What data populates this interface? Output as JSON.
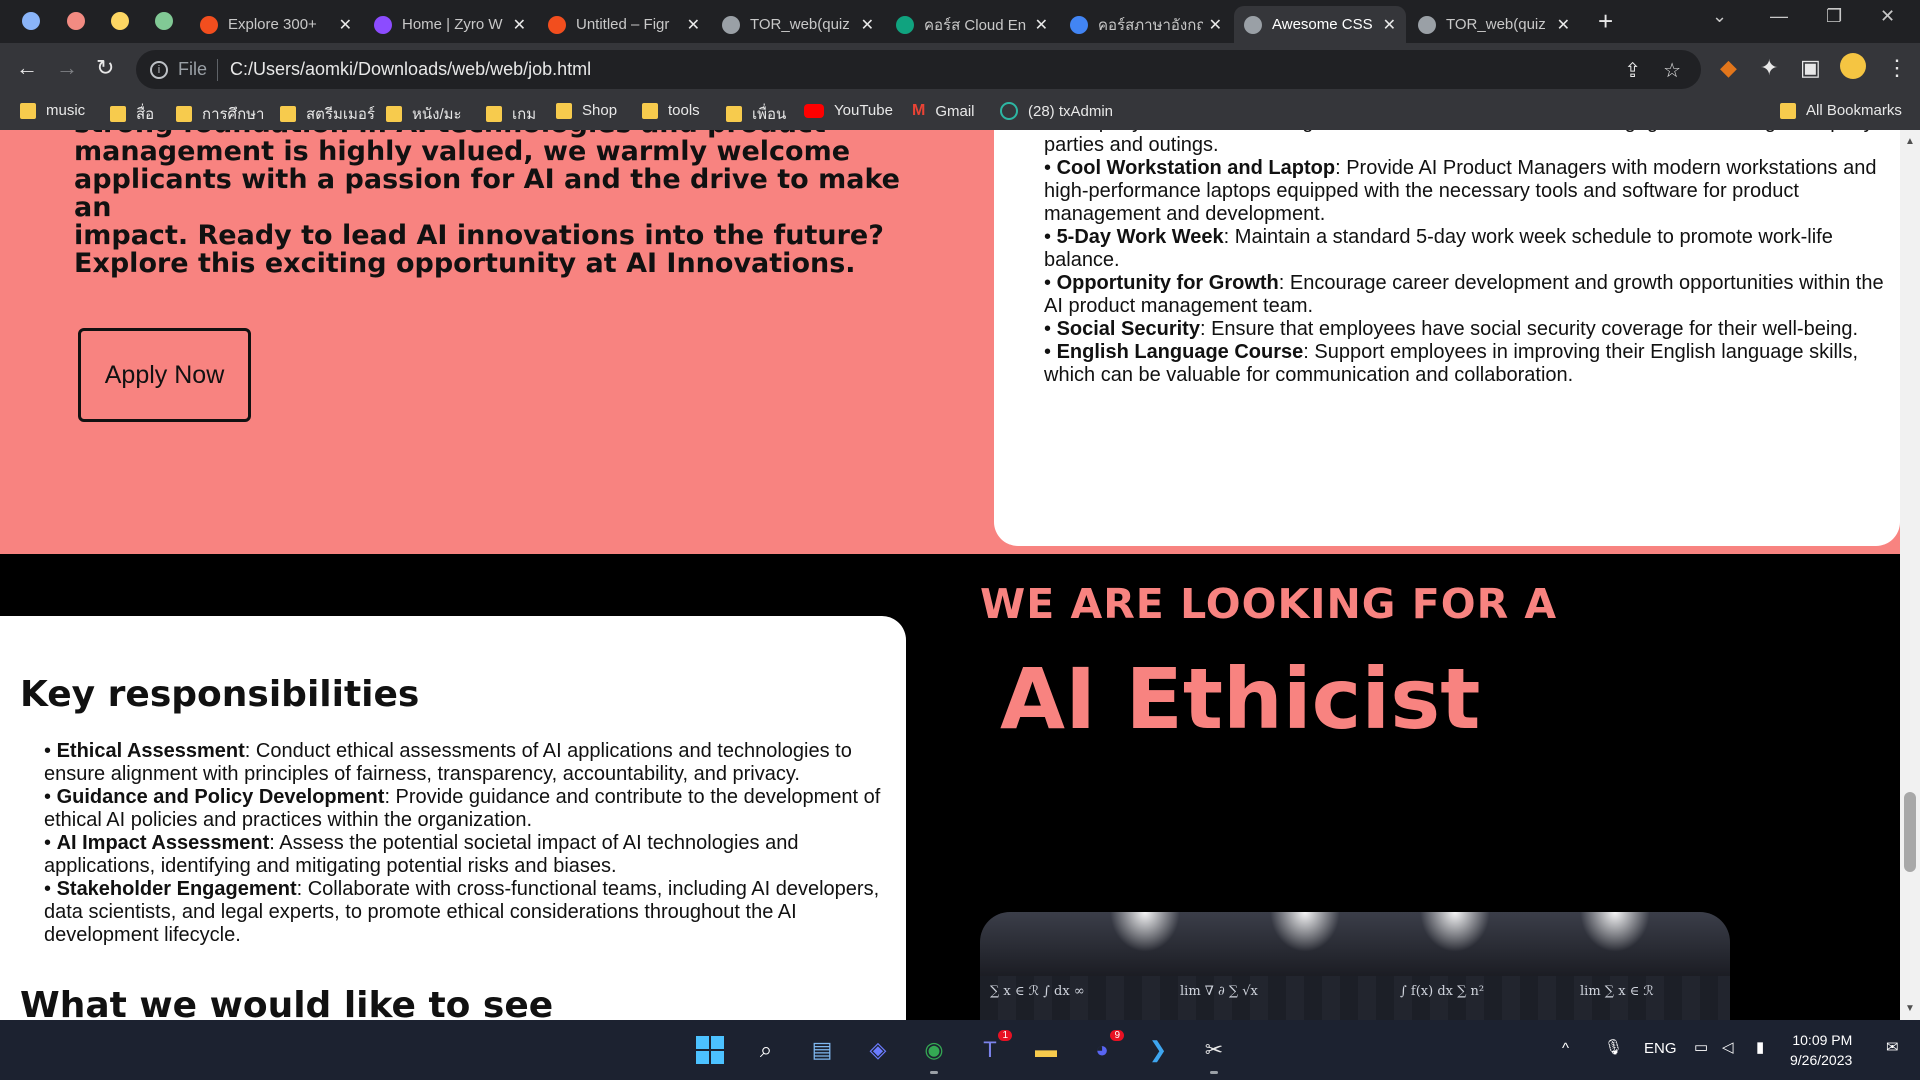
{
  "browser": {
    "tabs": [
      {
        "label": "Explore 300+",
        "favicon_color": "#f24e1e"
      },
      {
        "label": "Home | Zyro W",
        "favicon_color": "#8c4cff"
      },
      {
        "label": "Untitled – Figr",
        "favicon_color": "#f24e1e"
      },
      {
        "label": "TOR_web(quiz",
        "favicon_color": "#9aa0a6"
      },
      {
        "label": "คอร์ส Cloud En",
        "favicon_color": "#10a37f"
      },
      {
        "label": "คอร์สภาษาอังกฤ",
        "favicon_color": "#4285f4"
      },
      {
        "label": "Awesome CSS",
        "favicon_color": "#9aa0a6"
      },
      {
        "label": "TOR_web(quiz",
        "favicon_color": "#9aa0a6"
      }
    ],
    "address": {
      "scheme": "File",
      "url": "C:/Users/aomki/Downloads/web/web/job.html"
    },
    "bookmarks": [
      {
        "label": "music",
        "type": "folder"
      },
      {
        "label": "สื่อ",
        "type": "folder"
      },
      {
        "label": "การศึกษา",
        "type": "folder"
      },
      {
        "label": "สตรีมเมอร์",
        "type": "folder"
      },
      {
        "label": "หนัง/มะ",
        "type": "folder"
      },
      {
        "label": "เกม",
        "type": "folder"
      },
      {
        "label": "Shop",
        "type": "folder"
      },
      {
        "label": "tools",
        "type": "folder"
      },
      {
        "label": "เพื่อน",
        "type": "folder"
      },
      {
        "label": "YouTube",
        "type": "youtube"
      },
      {
        "label": "Gmail",
        "type": "gmail"
      },
      {
        "label": "(28) txAdmin",
        "type": "txadmin"
      }
    ],
    "all_bookmarks": "All Bookmarks"
  },
  "page": {
    "intro_lines": [
      "strong foundation in AI technologies and product",
      "management is highly valued, we warmly welcome",
      "applicants with a passion for AI and the drive to make an",
      "impact. Ready to lead AI innovations into the future?",
      "Explore this exciting opportunity at AI Innovations."
    ],
    "apply_label": "Apply Now",
    "benefits_partial": "• Company Parties and Outings: Foster team camaraderie and engagement through company parties and outings.",
    "benefits": [
      {
        "title": "Cool Workstation and Laptop",
        "text": ": Provide AI Product Managers with modern workstations and high-performance laptops equipped with the necessary tools and software for product management and development."
      },
      {
        "title": "5-Day Work Week",
        "text": ": Maintain a standard 5-day work week schedule to promote work-life balance."
      },
      {
        "title": "Opportunity for Growth",
        "text": ": Encourage career development and growth opportunities within the AI product management team."
      },
      {
        "title": "Social Security",
        "text": ": Ensure that employees have social security coverage for their well-being."
      },
      {
        "title": "English Language Course",
        "text": ": Support employees in improving their English language skills, which can be valuable for communication and collaboration."
      }
    ],
    "key_heading": "Key responsibilities",
    "responsibilities": [
      {
        "title": "Ethical Assessment",
        "text": ": Conduct ethical assessments of AI applications and technologies to ensure alignment with principles of fairness, transparency, accountability, and privacy."
      },
      {
        "title": "Guidance and Policy Development",
        "text": ": Provide guidance and contribute to the development of ethical AI policies and practices within the organization."
      },
      {
        "title": "AI Impact Assessment",
        "text": ": Assess the potential societal impact of AI technologies and applications, identifying and mitigating potential risks and biases."
      },
      {
        "title": "Stakeholder Engagement",
        "text": ": Collaborate with cross-functional teams, including AI developers, data scientists, and legal experts, to promote ethical considerations throughout the AI development lifecycle."
      }
    ],
    "see_heading": "What we would like to see",
    "looking_for": "WE ARE LOOKING FOR A",
    "role": "AI Ethicist",
    "accent_color": "#f88380"
  },
  "taskbar": {
    "language": "ENG",
    "time": "10:09 PM",
    "date": "9/26/2023",
    "teams_badge": "1",
    "discord_badge": "9"
  }
}
